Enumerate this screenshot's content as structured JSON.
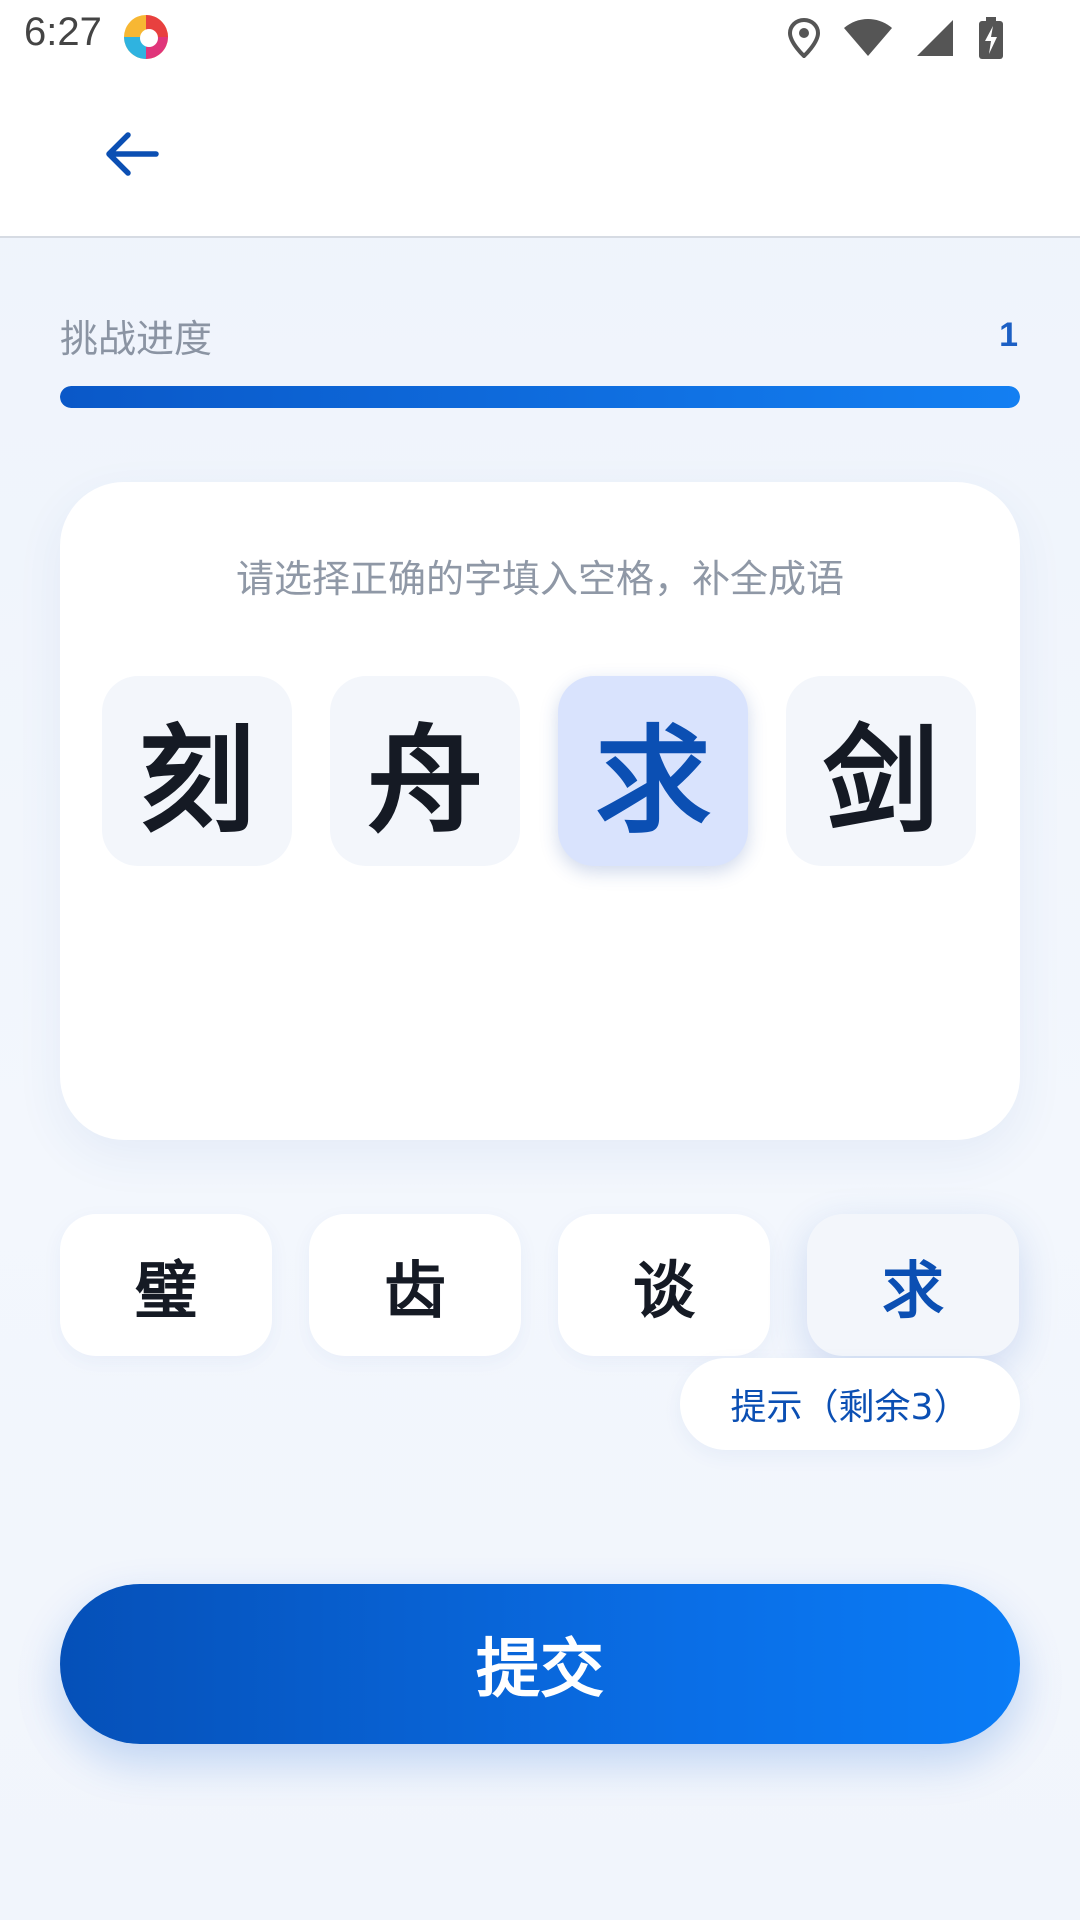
{
  "status_bar": {
    "time": "6:27",
    "icons": [
      "app-logo-icon",
      "location-icon",
      "wifi-icon",
      "cell-signal-icon",
      "battery-charging-icon"
    ]
  },
  "header": {
    "back_icon": "arrow-left-icon"
  },
  "progress": {
    "label": "挑战进度",
    "count": "1",
    "fraction": 1.0
  },
  "puzzle": {
    "instruction": "请选择正确的字填入空格，补全成语",
    "slots": [
      {
        "char": "刻",
        "filled": false
      },
      {
        "char": "舟",
        "filled": false
      },
      {
        "char": "求",
        "filled": true
      },
      {
        "char": "剑",
        "filled": false
      }
    ]
  },
  "options": [
    {
      "char": "璧",
      "selected": false
    },
    {
      "char": "齿",
      "selected": false
    },
    {
      "char": "谈",
      "selected": false
    },
    {
      "char": "求",
      "selected": true
    }
  ],
  "hint_button_label": "提示（剩余3）",
  "submit_button_label": "提交",
  "colors": {
    "accent": "#0b4fb3",
    "primary_gradient_start": "#0550b8",
    "primary_gradient_end": "#0a7cf6",
    "filled_slot_bg": "#d9e3fd"
  }
}
